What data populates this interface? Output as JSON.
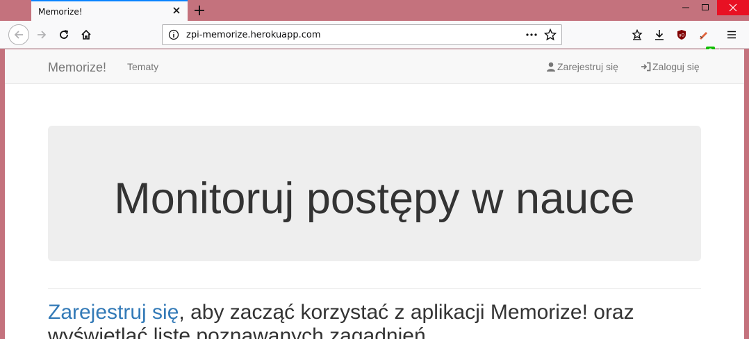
{
  "browser": {
    "tab_title": "Memorize!",
    "url": "zpi-memorize.herokuapp.com",
    "extension_badge": "0"
  },
  "navbar": {
    "brand": "Memorize!",
    "topics": "Tematy",
    "register": "Zarejestruj się",
    "login": "Zaloguj się"
  },
  "jumbotron": {
    "title": "Monitoruj postępy w nauce"
  },
  "lead": {
    "link": "Zarejestruj się",
    "text": ", aby zacząć korzystać z aplikacji Memorize! oraz wyświetlać listę poznawanych zagadnień."
  }
}
